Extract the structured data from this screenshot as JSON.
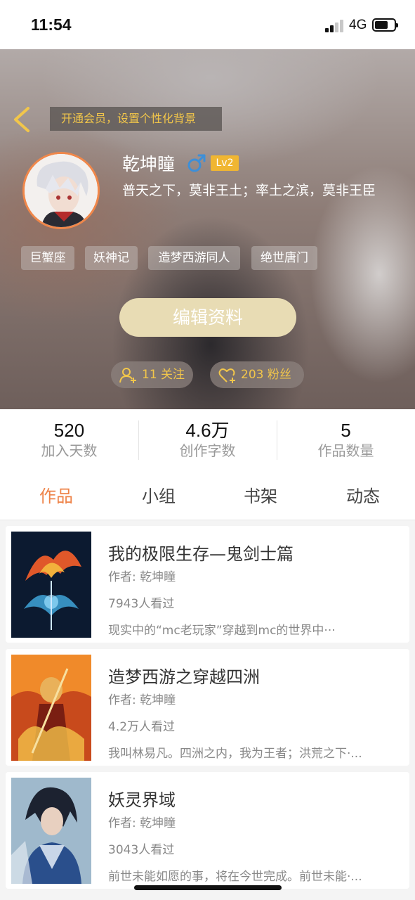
{
  "status_bar": {
    "time": "11:54",
    "network": "4G"
  },
  "header": {
    "vip_banner": "开通会员，设置个性化背景",
    "user_name": "乾坤瞳",
    "level": "Lv2",
    "signature": "普天之下，莫非王土；率土之滨，莫非王臣",
    "tags": [
      "巨蟹座",
      "妖神记",
      "造梦西游同人",
      "绝世唐门"
    ],
    "edit_button": "编辑资料",
    "following": "11 关注",
    "followers": "203 粉丝"
  },
  "stats": [
    {
      "value": "520",
      "label": "加入天数"
    },
    {
      "value": "4.6万",
      "label": "创作字数"
    },
    {
      "value": "5",
      "label": "作品数量"
    }
  ],
  "tabs": [
    "作品",
    "小组",
    "书架",
    "动态"
  ],
  "active_tab": "作品",
  "books": [
    {
      "title": "我的极限生存—鬼剑士篇",
      "author": "作者: 乾坤瞳",
      "views": "7943人看过",
      "description": "现实中的“mc老玩家”穿越到mc的世界中···"
    },
    {
      "title": "造梦西游之穿越四洲",
      "author": "作者: 乾坤瞳",
      "views": "4.2万人看过",
      "description": "我叫林易凡。四洲之内，我为王者；洪荒之下·..."
    },
    {
      "title": "妖灵界域",
      "author": "作者: 乾坤瞳",
      "views": "3043人看过",
      "description": "前世未能如愿的事，将在今世完成。前世未能·..."
    }
  ],
  "colors": {
    "accent": "#ee8247",
    "gold": "#f2c64a",
    "level_badge": "#f0b632",
    "gender": "#3d8fd8"
  }
}
